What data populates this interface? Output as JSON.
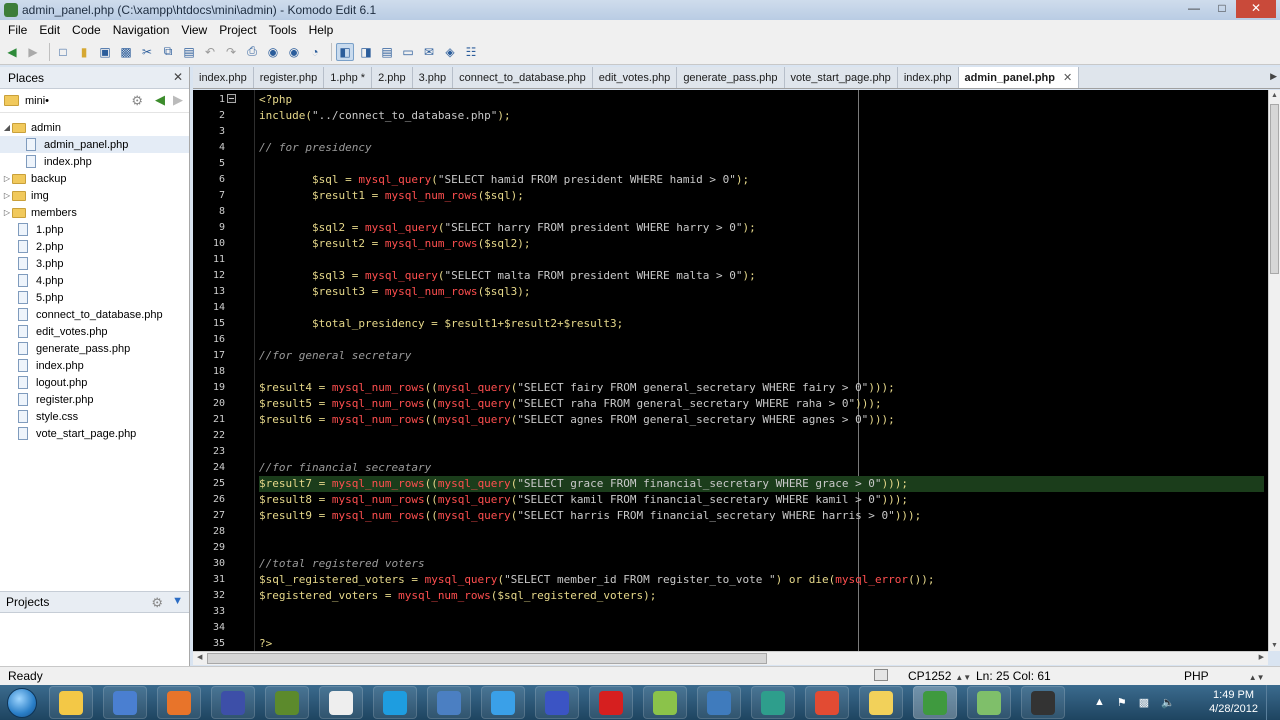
{
  "window": {
    "title": "admin_panel.php (C:\\xampp\\htdocs\\mini\\admin) - Komodo Edit 6.1",
    "buttons": [
      "minimize",
      "maximize",
      "close"
    ]
  },
  "menu": [
    "File",
    "Edit",
    "Code",
    "Navigation",
    "View",
    "Project",
    "Tools",
    "Help"
  ],
  "toolbar": {
    "icons": [
      "back-icon",
      "forward-icon",
      "new-file-icon",
      "open-icon",
      "save-icon",
      "save-all-icon",
      "cut-icon",
      "copy-icon",
      "paste-icon",
      "undo-icon",
      "redo-icon",
      "print-icon",
      "preview-icon",
      "debug-icon",
      "browser-icon",
      "left-pane-icon",
      "right-pane-icon",
      "bottom-pane-icon",
      "full-screen-icon",
      "find-icon",
      "replace-icon"
    ]
  },
  "places": {
    "header": "Places",
    "root": "mini",
    "tree": [
      {
        "label": "admin",
        "type": "folder",
        "expanded": true,
        "level": 0
      },
      {
        "label": "admin_panel.php",
        "type": "file",
        "level": 1,
        "selected": true
      },
      {
        "label": "index.php",
        "type": "file",
        "level": 1
      },
      {
        "label": "backup",
        "type": "folder",
        "expanded": false,
        "level": 0
      },
      {
        "label": "img",
        "type": "folder",
        "expanded": false,
        "level": 0
      },
      {
        "label": "members",
        "type": "folder",
        "expanded": false,
        "level": 0
      },
      {
        "label": "1.php",
        "type": "file",
        "level": 0
      },
      {
        "label": "2.php",
        "type": "file",
        "level": 0
      },
      {
        "label": "3.php",
        "type": "file",
        "level": 0
      },
      {
        "label": "4.php",
        "type": "file",
        "level": 0
      },
      {
        "label": "5.php",
        "type": "file",
        "level": 0
      },
      {
        "label": "connect_to_database.php",
        "type": "file",
        "level": 0
      },
      {
        "label": "edit_votes.php",
        "type": "file",
        "level": 0
      },
      {
        "label": "generate_pass.php",
        "type": "file",
        "level": 0
      },
      {
        "label": "index.php",
        "type": "file",
        "level": 0
      },
      {
        "label": "logout.php",
        "type": "file",
        "level": 0
      },
      {
        "label": "register.php",
        "type": "file",
        "level": 0
      },
      {
        "label": "style.css",
        "type": "file",
        "level": 0
      },
      {
        "label": "vote_start_page.php",
        "type": "file",
        "level": 0
      }
    ]
  },
  "projects": {
    "header": "Projects"
  },
  "tabs": [
    {
      "label": "index.php",
      "active": false
    },
    {
      "label": "register.php",
      "active": false
    },
    {
      "label": "1.php *",
      "active": false
    },
    {
      "label": "2.php",
      "active": false
    },
    {
      "label": "3.php",
      "active": false
    },
    {
      "label": "connect_to_database.php",
      "active": false
    },
    {
      "label": "edit_votes.php",
      "active": false
    },
    {
      "label": "generate_pass.php",
      "active": false
    },
    {
      "label": "vote_start_page.php",
      "active": false
    },
    {
      "label": "index.php",
      "active": false
    },
    {
      "label": "admin_panel.php",
      "active": true
    }
  ],
  "editor": {
    "current_line": 25,
    "lines": [
      "<?php",
      "include(\"../connect_to_database.php\");",
      "",
      "// for presidency",
      "",
      "        $sql = mysql_query(\"SELECT hamid FROM president WHERE hamid > 0\");",
      "        $result1 = mysql_num_rows($sql);",
      "",
      "        $sql2 = mysql_query(\"SELECT harry FROM president WHERE harry > 0\");",
      "        $result2 = mysql_num_rows($sql2);",
      "",
      "        $sql3 = mysql_query(\"SELECT malta FROM president WHERE malta > 0\");",
      "        $result3 = mysql_num_rows($sql3);",
      "",
      "        $total_presidency = $result1+$result2+$result3;",
      "",
      "//for general secretary",
      "",
      "$result4 = mysql_num_rows((mysql_query(\"SELECT fairy FROM general_secretary WHERE fairy > 0\")));",
      "$result5 = mysql_num_rows((mysql_query(\"SELECT raha FROM general_secretary WHERE raha > 0\")));",
      "$result6 = mysql_num_rows((mysql_query(\"SELECT agnes FROM general_secretary WHERE agnes > 0\")));",
      "",
      "",
      "//for financial secreatary",
      "$result7 = mysql_num_rows((mysql_query(\"SELECT grace FROM financial_secretary WHERE grace > 0\")));",
      "$result8 = mysql_num_rows((mysql_query(\"SELECT kamil FROM financial_secretary WHERE kamil > 0\")));",
      "$result9 = mysql_num_rows((mysql_query(\"SELECT harris FROM financial_secretary WHERE harris > 0\")));",
      "",
      "",
      "//total registered voters",
      "$sql_registered_voters = mysql_query(\"SELECT member_id FROM register_to_vote \") or die(mysql_error());",
      "$registered_voters = mysql_num_rows($sql_registered_voters);",
      "",
      "",
      "?>"
    ]
  },
  "status": {
    "ready": "Ready",
    "encoding": "CP1252",
    "position": "Ln: 25 Col: 61",
    "language": "PHP"
  },
  "taskbar": {
    "apps": [
      "explorer",
      "media-player",
      "firefox",
      "app-loop",
      "dreamweaver",
      "unity",
      "skype",
      "virtualbox",
      "safari",
      "app-sphere",
      "opera",
      "android",
      "python",
      "app-g",
      "chrome",
      "folder",
      "komodo",
      "notepad",
      "cmd"
    ],
    "time": "1:49 PM",
    "date": "4/28/2012"
  }
}
